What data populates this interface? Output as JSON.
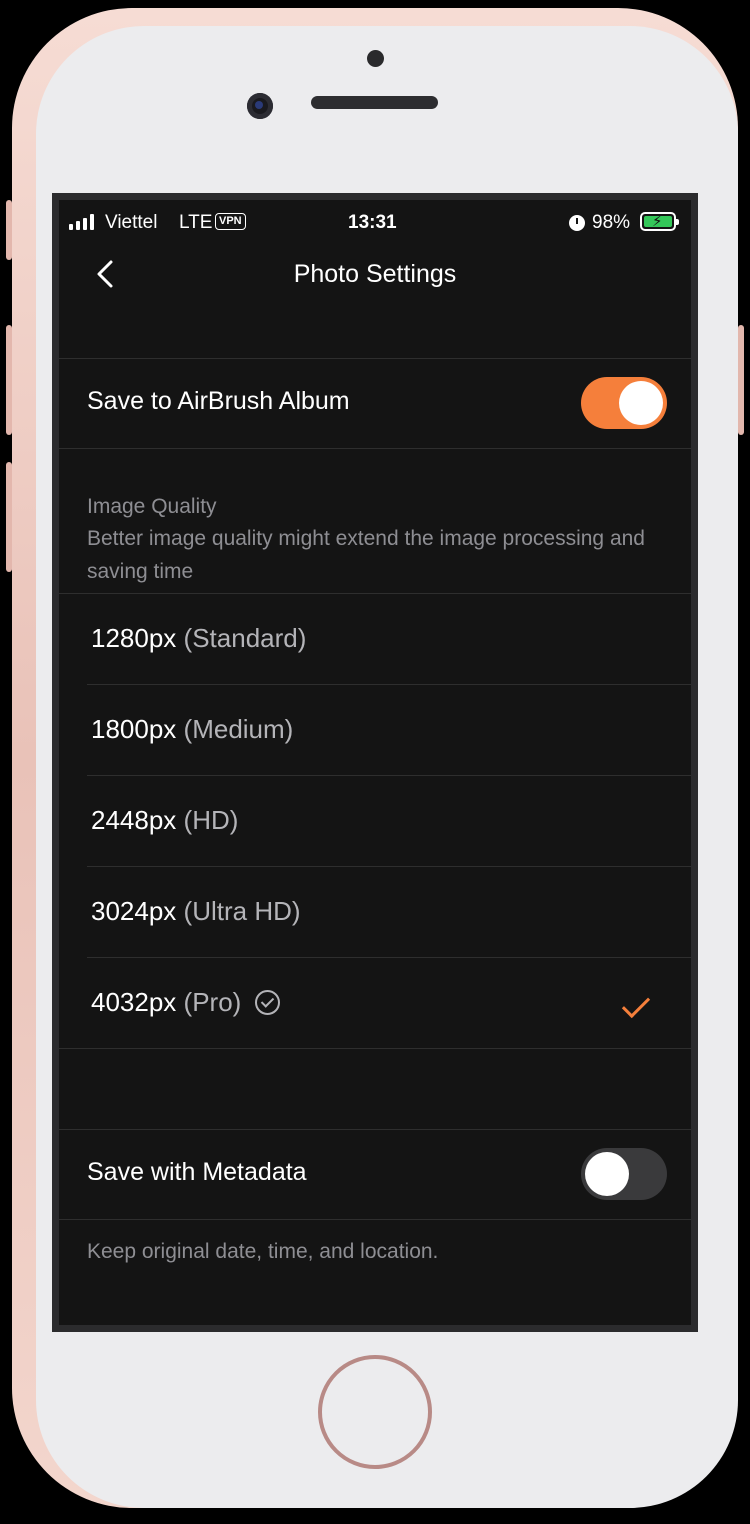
{
  "status_bar": {
    "carrier": "Viettel",
    "network": "LTE",
    "vpn": "VPN",
    "time": "13:31",
    "battery": "98%"
  },
  "nav": {
    "title": "Photo Settings",
    "back_icon": "chevron-left-icon"
  },
  "album": {
    "label": "Save to AirBrush Album",
    "enabled": true
  },
  "image_quality": {
    "title": "Image Quality",
    "description": "Better image quality might extend the image processing and saving time",
    "options": [
      {
        "size": "1280px",
        "name": "(Standard)",
        "selected": false,
        "pro": false
      },
      {
        "size": "1800px",
        "name": "(Medium)",
        "selected": false,
        "pro": false
      },
      {
        "size": "2448px",
        "name": "(HD)",
        "selected": false,
        "pro": false
      },
      {
        "size": "3024px",
        "name": "(Ultra HD)",
        "selected": false,
        "pro": false
      },
      {
        "size": "4032px",
        "name": "(Pro)",
        "selected": true,
        "pro": true
      }
    ]
  },
  "metadata": {
    "label": "Save with Metadata",
    "enabled": false,
    "description": "Keep original date, time, and location."
  },
  "colors": {
    "accent": "#f57f3b",
    "background": "#141414",
    "secondary_text": "#8e8e93"
  }
}
